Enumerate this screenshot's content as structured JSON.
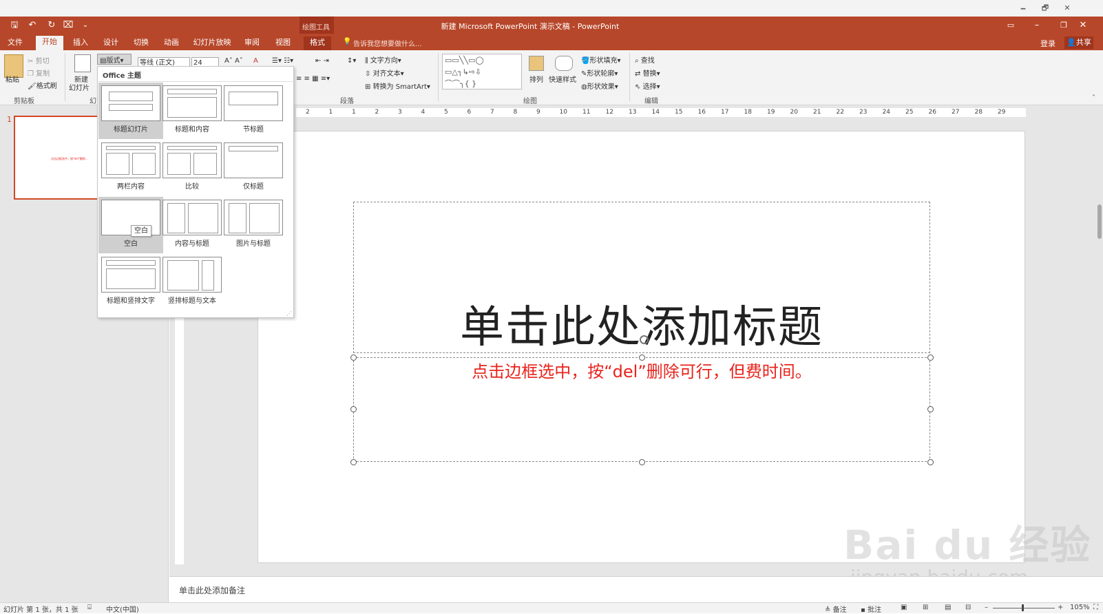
{
  "window": {
    "title": "新建 Microsoft PowerPoint 演示文稿 - PowerPoint",
    "context_tab_group": "绘图工具",
    "controls": [
      "🗕",
      "🗗",
      "✕"
    ]
  },
  "tabs": [
    "文件",
    "开始",
    "插入",
    "设计",
    "切换",
    "动画",
    "幻灯片放映",
    "审阅",
    "视图",
    "格式"
  ],
  "tell_me": "告诉我您想要做什么...",
  "login": "登录",
  "share": "共享",
  "ribbon": {
    "clipboard": {
      "paste": "粘贴",
      "cut": "剪切",
      "copy": "复制",
      "format_painter": "格式刷",
      "label": "剪贴板"
    },
    "slides": {
      "new_slide": "新建",
      "new_slide2": "幻灯片",
      "layout": "版式",
      "label": "幻"
    },
    "font": {
      "name": "等线 (正文)",
      "size": "24"
    },
    "paragraph": {
      "text_direction": "文字方向",
      "align_text": "对齐文本",
      "smartart": "转换为 SmartArt",
      "label": "段落"
    },
    "drawing": {
      "arrange": "排列",
      "quick_styles": "快速样式",
      "shape_fill": "形状填充",
      "shape_outline": "形状轮廓",
      "shape_effects": "形状效果",
      "label": "绘图"
    },
    "editing": {
      "find": "查找",
      "replace": "替换",
      "select": "选择",
      "label": "编辑"
    }
  },
  "layout_panel": {
    "header": "Office 主题",
    "items": [
      "标题幻灯片",
      "标题和内容",
      "节标题",
      "两栏内容",
      "比较",
      "仅标题",
      "空白",
      "内容与标题",
      "图片与标题",
      "标题和竖排文字",
      "竖排标题与文本"
    ],
    "tooltip": "空白"
  },
  "thumb": {
    "number": "1",
    "text": "点击边框选中，按\"del\"删除..."
  },
  "ruler": {
    "h_ticks": [
      "2",
      "1",
      "1",
      "2",
      "3",
      "4",
      "5",
      "6",
      "7",
      "8",
      "9",
      "10",
      "11",
      "12",
      "13",
      "14",
      "15",
      "16",
      "17",
      "18",
      "19",
      "20",
      "21",
      "22",
      "23",
      "24",
      "25",
      "26",
      "27",
      "28",
      "29"
    ]
  },
  "slide": {
    "title_placeholder": "单击此处添加标题",
    "subtitle_text": "点击边框选中，按“del”删除可行，但费时间。"
  },
  "notes": {
    "placeholder": "单击此处添加备注"
  },
  "status": {
    "slide_info": "幻灯片 第 1 张，共 1 张",
    "language": "中文(中国)",
    "notes": "备注",
    "comments": "批注",
    "zoom": "105%"
  },
  "watermark": {
    "logo": "Bai du 经验",
    "url": "jingyan.baidu.com"
  },
  "colors": {
    "accent": "#b7472a",
    "selection": "#d24726",
    "red_text": "#e8231c"
  }
}
